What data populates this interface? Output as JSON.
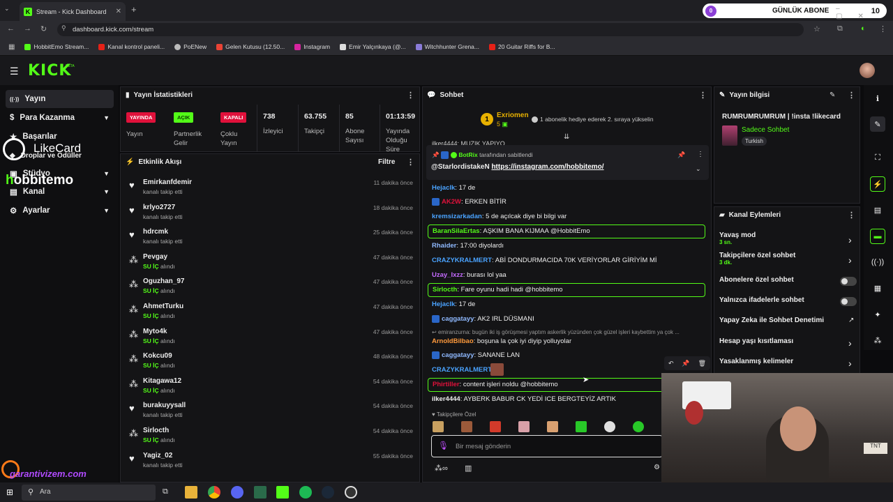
{
  "browser": {
    "tab_title": "Stream - Kick Dashboard",
    "url": "dashboard.kick.com/stream",
    "bookmarks": [
      "HobbitEmo Stream...",
      "Kanal kontrol paneli...",
      "PoENew",
      "Gelen Kutusu (12.50...",
      "Instagram",
      "Emir Yalçınkaya (@...",
      "Witchhunter Grena...",
      "20 Guitar Riffs for B..."
    ],
    "bookmark_colors": [
      "#53fc18",
      "#e62117",
      "#bbbbbb",
      "#ea4335",
      "#d6249f",
      "#dddddd",
      "#8a7bd8",
      "#e62117"
    ]
  },
  "overlay": {
    "sub_avatar": "0",
    "sub_label": "GÜNLÜK ABONE",
    "sub_count": "10",
    "likecard": "LikeCard",
    "hobbit_prefix": "h",
    "hobbit_name": "obbitemo",
    "garanti": "garantivizem.com"
  },
  "kick": {
    "logo": "KICK",
    "beta": "BETA"
  },
  "nav": [
    {
      "label": "Yayın",
      "icon": "((·))"
    },
    {
      "label": "Para Kazanma",
      "icon": "$"
    },
    {
      "label": "Başarılar",
      "icon": "★"
    },
    {
      "label": "Droplar ve Ödüller",
      "icon": "◆"
    },
    {
      "label": "Stüdyo",
      "icon": "▣"
    },
    {
      "label": "Kanal",
      "icon": "▤"
    },
    {
      "label": "Ayarlar",
      "icon": "⚙"
    }
  ],
  "stats": {
    "title": "Yayın İstatistikleri",
    "badges": [
      {
        "text": "YAYINDA",
        "label": "Yayın",
        "bg": "#e0113b",
        "fg": "#ffffff"
      },
      {
        "text": "AÇIK",
        "label": "Partnerlik\nGelir",
        "bg": "#53fc18",
        "fg": "#0b3d00"
      },
      {
        "text": "KAPALI",
        "label": "Çoklu\nYayın",
        "bg": "#e0113b",
        "fg": "#ffffff"
      }
    ],
    "values": [
      {
        "value": "738",
        "label": "İzleyici"
      },
      {
        "value": "63.755",
        "label": "Takipçi"
      },
      {
        "value": "85",
        "label": "Abone\nSayısı"
      },
      {
        "value": "01:13:59",
        "label": "Yayında\nOlduğu\nSüre"
      }
    ]
  },
  "activity": {
    "title": "Etkinlik Akışı",
    "filter": "Filtre",
    "items": [
      {
        "name": "Emirkanfdemir",
        "type": "follow",
        "action": "kanalı takip etti",
        "item": "",
        "time": "11 dakika önce"
      },
      {
        "name": "krlyo2727",
        "type": "follow",
        "action": "kanalı takip etti",
        "item": "",
        "time": "18 dakika önce"
      },
      {
        "name": "hdrcmk",
        "type": "follow",
        "action": "kanalı takip etti",
        "item": "",
        "time": "25 dakika önce"
      },
      {
        "name": "Pevgay",
        "type": "reward",
        "action": "alındı",
        "item": "SU İÇ",
        "time": "47 dakika önce"
      },
      {
        "name": "Oguzhan_97",
        "type": "reward",
        "action": "alındı",
        "item": "SU İÇ",
        "time": "47 dakika önce"
      },
      {
        "name": "AhmetTurku",
        "type": "reward",
        "action": "alındı",
        "item": "SU İÇ",
        "time": "47 dakika önce"
      },
      {
        "name": "Myto4k",
        "type": "reward",
        "action": "alındı",
        "item": "SU İÇ",
        "time": "47 dakika önce"
      },
      {
        "name": "Kokcu09",
        "type": "reward",
        "action": "alındı",
        "item": "SU İÇ",
        "time": "48 dakika önce"
      },
      {
        "name": "Kitagawa12",
        "type": "reward",
        "action": "alındı",
        "item": "SU İÇ",
        "time": "54 dakika önce"
      },
      {
        "name": "burakuyysall",
        "type": "follow",
        "action": "kanalı takip etti",
        "item": "",
        "time": "54 dakika önce"
      },
      {
        "name": "Sirlocth",
        "type": "reward",
        "action": "alındı",
        "item": "SU İÇ",
        "time": "54 dakika önce"
      },
      {
        "name": "Yagiz_02",
        "type": "follow",
        "action": "kanalı takip etti",
        "item": "",
        "time": "55 dakika önce"
      }
    ]
  },
  "chat": {
    "title": "Sohbet",
    "top_gifter_rank": "1",
    "top_gifter": "Exriomen",
    "top_gifter_count": "5",
    "gift_info": "1 abonelik hediye ederek 2. sıraya yükselin",
    "cut_line": "ilker4444: MUZIK YAPIYO",
    "pinned_by": "BotRix",
    "pinned_by_suffix": "tarafından sabitlendi",
    "pinned_user": "@StarlordistakeN",
    "pinned_link": "https://instagram.com/hobbitemo/",
    "messages": [
      {
        "user": "Hejaclk",
        "color": "#4aa3ff",
        "text": "17 de",
        "highlight": false,
        "icon": false
      },
      {
        "user": "AK2W",
        "color": "#e0113b",
        "text": "ERKEN BİTİR",
        "highlight": false,
        "icon": true
      },
      {
        "user": "kremsizarkadan",
        "color": "#4aa3ff",
        "text": "5 de açılcak diye bi bilgi var",
        "highlight": false,
        "icon": false
      },
      {
        "user": "BaranSilaErtas",
        "color": "#53fc18",
        "text": "AŞKIM BANA KIJMAA @HobbitEmo",
        "highlight": true,
        "icon": false
      },
      {
        "user": "Rhaider",
        "color": "#8fb9ff",
        "text": "17:00 diyolardı",
        "highlight": false,
        "icon": false
      },
      {
        "user": "CRAZYKRALMERT",
        "color": "#4aa3ff",
        "text": "ABİ DONDURMACIDA 70K VERİYORLAR GİRİYİM Mİ",
        "highlight": false,
        "icon": false
      },
      {
        "user": "Uzay_Ixzz",
        "color": "#c56bff",
        "text": "burası lol yaa",
        "highlight": false,
        "icon": false
      },
      {
        "user": "Sirlocth",
        "color": "#53fc18",
        "text": "Fare oyunu hadi hadi @hobbitemo",
        "highlight": true,
        "icon": false
      },
      {
        "user": "Hejaclk",
        "color": "#4aa3ff",
        "text": "17 de",
        "highlight": false,
        "icon": false
      },
      {
        "user": "caggatayy",
        "color": "#8fb9ff",
        "text": "AK2 IRL DÜSMANI",
        "highlight": false,
        "icon": true
      },
      {
        "user": "ArnoldBilbao",
        "color": "#ff9a3c",
        "text": "boşuna la çok iyi diyip yolluyolar",
        "highlight": false,
        "icon": false
      },
      {
        "user": "caggatayy",
        "color": "#8fb9ff",
        "text": "SANANE LAN",
        "highlight": false,
        "icon": true
      },
      {
        "user": "CRAZYKRALMERT",
        "color": "#4aa3ff",
        "text": "",
        "highlight": false,
        "icon": false
      },
      {
        "user": "Phirtiller",
        "color": "#e0113b",
        "text": "content işleri noldu @hobbitemo",
        "highlight": true,
        "icon": false
      },
      {
        "user": "ilker4444",
        "color": "#eeeeee",
        "text": "AYBERK BABUR CK YEDİ ICE BERGTEYİZ ARTIK",
        "highlight": false,
        "icon": false
      }
    ],
    "reply_preview": "emiranzurna: bugün iki iş görüşmesi yaptım askerlik yüzünden çok güzel işleri kaybettim ya çok ...",
    "emote_label": "Takipçilere Özel",
    "input_placeholder": "Bir mesaj gönderin"
  },
  "info": {
    "title": "Yayın bilgisi",
    "stream_title": "RUMRUMRUMRUM | !insta !likecard",
    "category": "Sadece Sohbet",
    "language": "Turkish"
  },
  "actions": {
    "title": "Kanal Eylemleri",
    "items": [
      {
        "label": "Yavaş mod",
        "sub": "3 sn.",
        "control": "chevron"
      },
      {
        "label": "Takipçilere özel sohbet",
        "sub": "3 dk.",
        "control": "chevron"
      },
      {
        "label": "Abonelere özel sohbet",
        "sub": "",
        "control": "toggle"
      },
      {
        "label": "Yalnızca ifadelerle sohbet",
        "sub": "",
        "control": "toggle"
      },
      {
        "label": "Yapay Zeka ile Sohbet Denetimi",
        "sub": "",
        "control": "external"
      },
      {
        "label": "Hesap yaşı kısıtlaması",
        "sub": "",
        "control": "chevron"
      },
      {
        "label": "Yasaklanmış kelimeler",
        "sub": "",
        "control": "chevron"
      }
    ]
  },
  "taskbar": {
    "search": "Ara"
  }
}
